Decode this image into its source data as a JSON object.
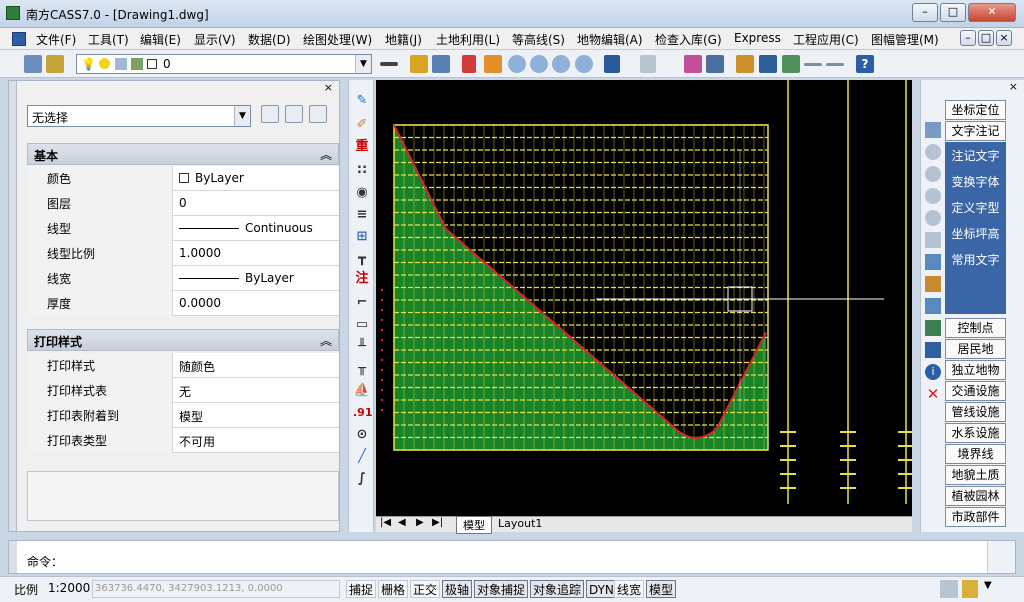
{
  "window": {
    "title": "南方CASS7.0 - [Drawing1.dwg]"
  },
  "menu": [
    "文件(F)",
    "工具(T)",
    "编辑(E)",
    "显示(V)",
    "数据(D)",
    "绘图处理(W)",
    "地籍(J)",
    "土地利用(L)",
    "等高线(S)",
    "地物编辑(A)",
    "检查入库(G)",
    "Express",
    "工程应用(C)",
    "图幅管理(M)"
  ],
  "layer_combo": {
    "value": "0"
  },
  "properties": {
    "selection": "无选择",
    "basic_title": "基本",
    "basic": [
      {
        "k": "颜色",
        "v": "ByLayer"
      },
      {
        "k": "图层",
        "v": "0"
      },
      {
        "k": "线型",
        "v": "Continuous"
      },
      {
        "k": "线型比例",
        "v": "1.0000"
      },
      {
        "k": "线宽",
        "v": "ByLayer"
      },
      {
        "k": "厚度",
        "v": "0.0000"
      }
    ],
    "print_title": "打印样式",
    "print": [
      {
        "k": "打印样式",
        "v": "随颜色"
      },
      {
        "k": "打印样式表",
        "v": "无"
      },
      {
        "k": "打印表附着到",
        "v": "模型"
      },
      {
        "k": "打印表类型",
        "v": "不可用"
      }
    ]
  },
  "left_tools": {
    "chong": "重",
    "zhu": "注",
    "num": ".91"
  },
  "tabs": {
    "model": "模型",
    "layout": "Layout1"
  },
  "right_panel": {
    "top_buttons": [
      "坐标定位",
      "文字注记"
    ],
    "blue_items": [
      "注记文字",
      "变换字体",
      "定义字型",
      "坐标坪高",
      "常用文字"
    ],
    "bottom_buttons": [
      "控制点",
      "居民地",
      "独立地物",
      "交通设施",
      "管线设施",
      "水系设施",
      "境界线",
      "地貌土质",
      "植被园林",
      "市政部件"
    ]
  },
  "command": {
    "prompt": "命令："
  },
  "status": {
    "scale_label": "比例",
    "scale": "1:2000",
    "coords": "363736.4470,  3427903.1213,  0.0000",
    "buttons": [
      "捕捉",
      "栅格",
      "正交",
      "极轴",
      "对象捕捉",
      "对象追踪",
      "DYN",
      "线宽",
      "模型"
    ]
  },
  "colors": {
    "accent_blue": "#3a66a8",
    "grid_yellow": "#e8e04a",
    "fill_green": "#1c9a2e",
    "curve_red": "#d8242a"
  }
}
